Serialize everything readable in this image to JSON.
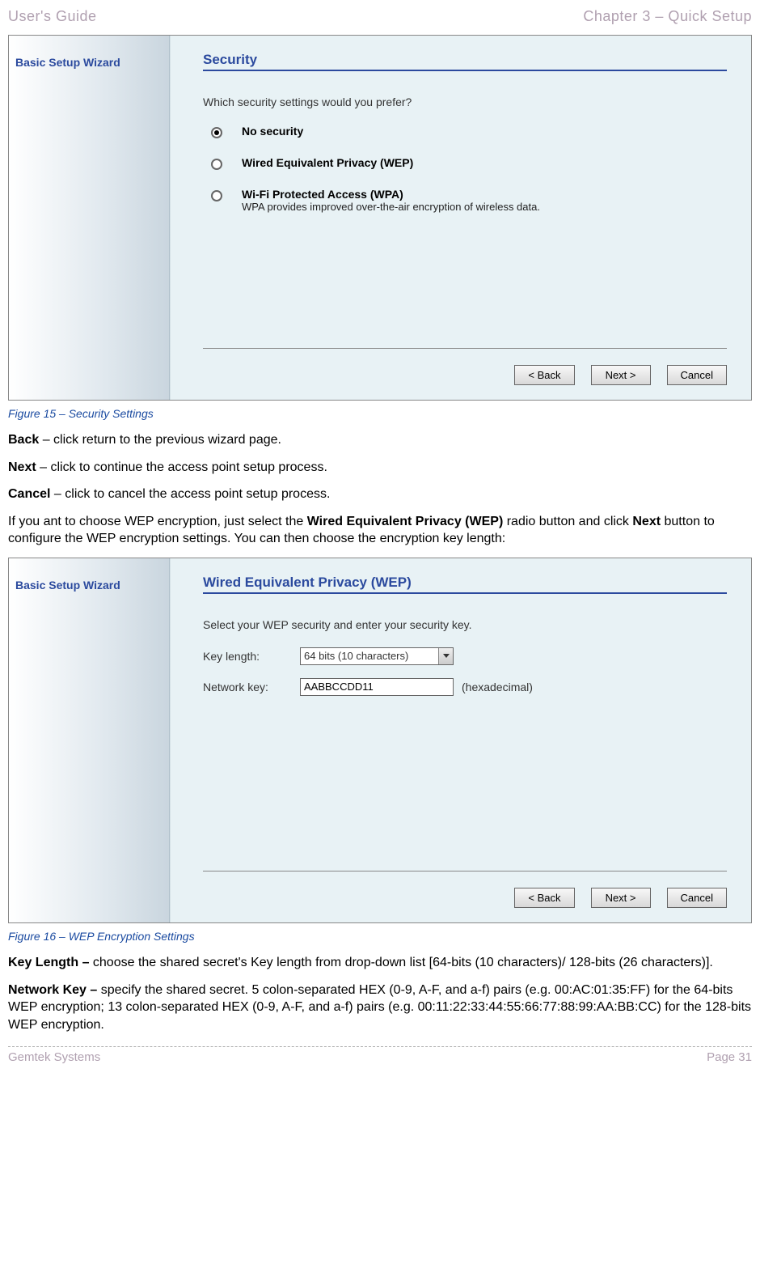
{
  "header": {
    "left": "User's Guide",
    "right": "Chapter 3 – Quick Setup"
  },
  "wizard1": {
    "sidebar_title": "Basic Setup Wizard",
    "title": "Security",
    "prompt": "Which security settings would you prefer?",
    "options": [
      {
        "label": "No security",
        "desc": "",
        "selected": true
      },
      {
        "label": "Wired Equivalent Privacy (WEP)",
        "desc": "",
        "selected": false
      },
      {
        "label": "Wi-Fi Protected Access (WPA)",
        "desc": "WPA provides improved over-the-air encryption of wireless data.",
        "selected": false
      }
    ],
    "back": "< Back",
    "next": "Next >",
    "cancel": "Cancel"
  },
  "caption1": "Figure 15 – Security Settings",
  "para_back_b": "Back",
  "para_back_t": " – click return to the previous wizard page.",
  "para_next_b": "Next",
  "para_next_t": " – click to continue the access point setup process.",
  "para_cancel_b": "Cancel",
  "para_cancel_t": " – click to cancel the access point setup process.",
  "para_wep_1": "If you ant to choose WEP encryption, just select the ",
  "para_wep_b1": "Wired Equivalent Privacy (WEP)",
  "para_wep_2": " radio button and click ",
  "para_wep_b2": "Next",
  "para_wep_3": " button to configure the WEP encryption settings. You can then choose the encryption key length:",
  "wizard2": {
    "sidebar_title": "Basic Setup Wizard",
    "title": "Wired Equivalent Privacy (WEP)",
    "prompt": "Select your WEP security and enter your security key.",
    "keylength_label": "Key length:",
    "keylength_value": "64 bits (10 characters)",
    "netkey_label": "Network key:",
    "netkey_value": "AABBCCDD11",
    "hex_note": "(hexadecimal)",
    "back": "< Back",
    "next": "Next >",
    "cancel": "Cancel"
  },
  "caption2": "Figure 16 – WEP Encryption Settings",
  "para_kl_b": "Key Length – ",
  "para_kl_t": "choose the shared secret's Key length from drop-down list [64-bits (10 characters)/ 128-bits (26 characters)].",
  "para_nk_b": "Network Key – ",
  "para_nk_t": "specify the shared secret. 5 colon-separated HEX (0-9, A-F, and a-f) pairs (e.g. 00:AC:01:35:FF) for the 64-bits WEP encryption; 13 colon-separated HEX (0-9, A-F, and a-f) pairs (e.g. 00:11:22:33:44:55:66:77:88:99:AA:BB:CC) for the 128-bits WEP encryption.",
  "footer": {
    "left": "Gemtek Systems",
    "right": "Page 31"
  }
}
